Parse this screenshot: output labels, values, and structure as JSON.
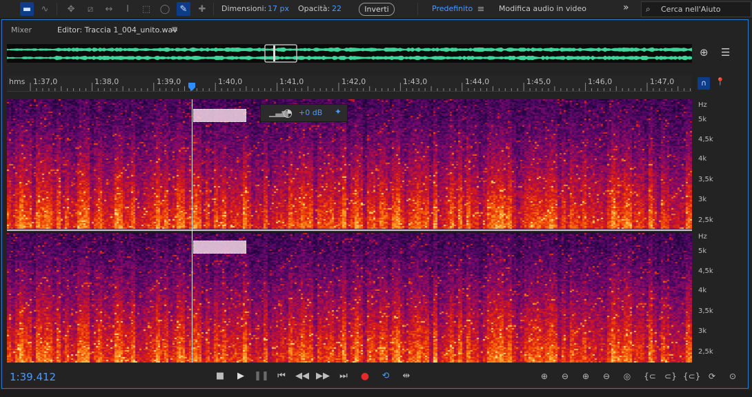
{
  "toolbar": {
    "size_label": "Dimensioni:",
    "size_value": "17 px",
    "opacity_label": "Opacità:",
    "opacity_value": "22",
    "invert_label": "Inverti",
    "workspace_default": "Predefinito",
    "workspace_video": "Modifica audio in video",
    "search_placeholder": "Cerca nell'Aiuto",
    "icons": [
      "waveform-view-icon",
      "spectral-view-icon",
      "move-tool-icon",
      "razor-tool-icon",
      "slip-tool-icon",
      "time-selection-tool-icon",
      "marquee-tool-icon",
      "lasso-tool-icon",
      "brush-tool-icon",
      "spot-healing-icon"
    ]
  },
  "tabs": {
    "mixer": "Mixer",
    "editor": "Editor: Traccia 1_004_unito.wav",
    "menu_icon": "≡"
  },
  "timeline": {
    "unit": "hms",
    "ticks": [
      "1:37,0",
      "1:38,0",
      "1:39,0",
      "1:40,0",
      "1:41,0",
      "1:42,0",
      "1:43,0",
      "1:44,0",
      "1:45,0",
      "1:46,0",
      "1:47,0"
    ]
  },
  "hz_axis": {
    "unit": "Hz",
    "labels": [
      "5k",
      "4,5k",
      "4k",
      "3,5k",
      "3k",
      "2,5k"
    ]
  },
  "hud": {
    "gain": "+0 dB"
  },
  "transport": {
    "current_time": "1:39.412",
    "buttons": [
      "stop-icon",
      "play-icon",
      "pause-icon",
      "go-to-start-icon",
      "rewind-icon",
      "fast-forward-icon",
      "go-to-end-icon",
      "record-icon",
      "loop-icon",
      "skip-selection-icon"
    ]
  },
  "zoom": {
    "buttons": [
      "zoom-in-amplitude-icon",
      "zoom-out-amplitude-icon",
      "zoom-in-time-icon",
      "zoom-out-time-icon",
      "zoom-to-selection-icon",
      "zoom-in-left-icon",
      "zoom-in-right-icon",
      "zoom-out-full-icon",
      "zoom-reset-icon",
      "zoom-freq-icon"
    ]
  },
  "colors": {
    "accent": "#4a9bff",
    "waveform": "#3fd59a",
    "record": "#e52a2a"
  }
}
